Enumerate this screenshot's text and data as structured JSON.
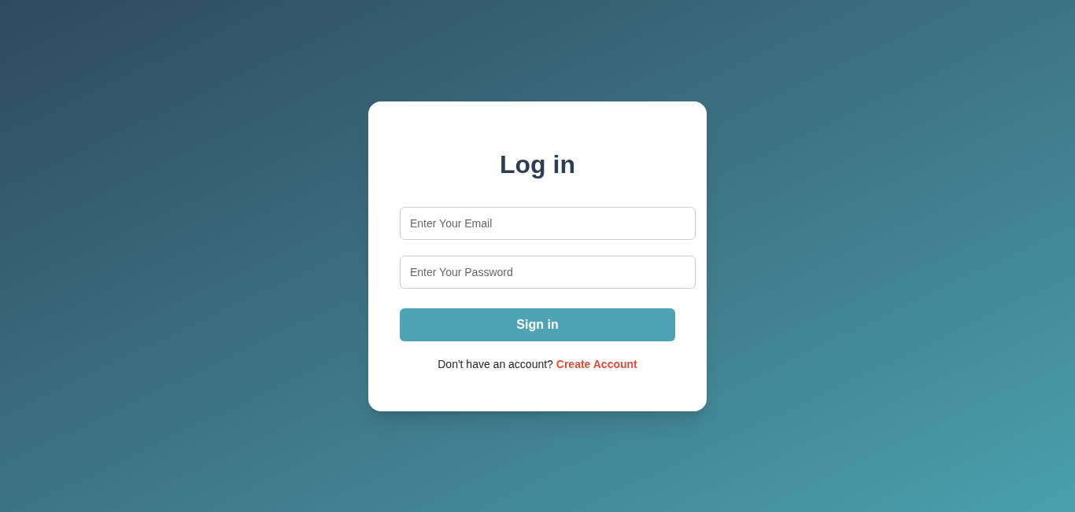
{
  "title": "Log in",
  "fields": [
    {
      "placeholder": "Enter Your Email"
    },
    {
      "placeholder": "Enter Your Password"
    }
  ],
  "submit": "Sign in",
  "footer": {
    "text": "Don't have an account?",
    "link": "Create Account"
  }
}
